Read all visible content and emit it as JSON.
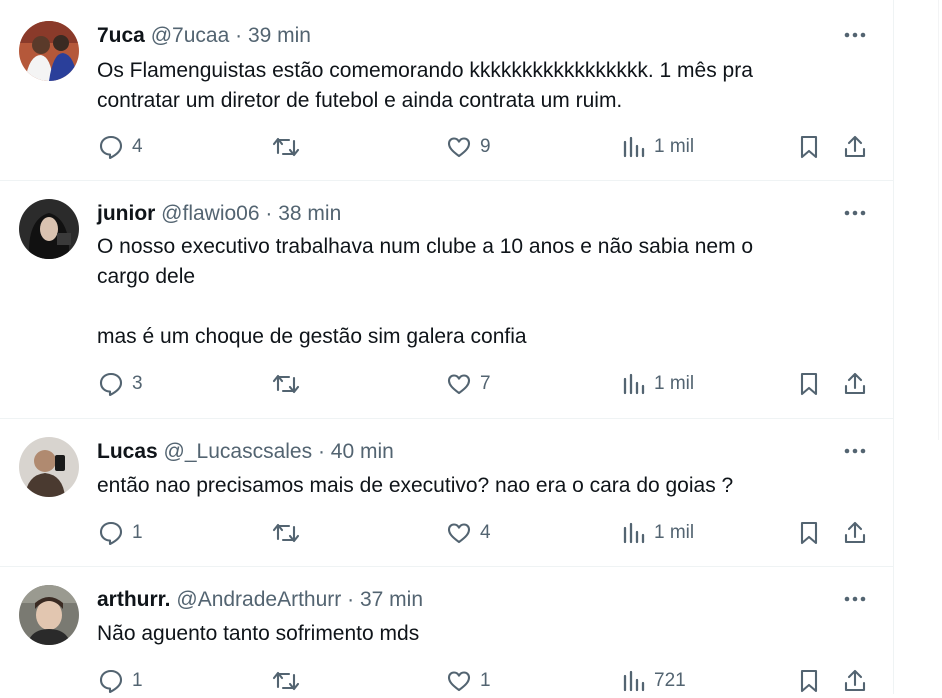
{
  "tweets": [
    {
      "name": "7uca",
      "handle": "@7ucaa",
      "dot": "·",
      "time": "39 min",
      "text": "Os Flamenguistas estão comemorando kkkkkkkkkkkkkkkkk. 1 mês pra\ncontratar um diretor de futebol e ainda contrata um ruim.",
      "replies": "4",
      "reposts": "",
      "likes": "9",
      "views": "1 mil"
    },
    {
      "name": "junior",
      "handle": "@flawio06",
      "dot": "·",
      "time": "38 min",
      "text": "O nosso executivo trabalhava num clube a 10 anos e não sabia nem o\ncargo dele\n\nmas é um choque de gestão sim galera confia",
      "replies": "3",
      "reposts": "",
      "likes": "7",
      "views": "1 mil"
    },
    {
      "name": "Lucas",
      "handle": "@_Lucascsales",
      "dot": "·",
      "time": "40 min",
      "text": "então nao precisamos mais de executivo? nao era o cara do goias ?",
      "replies": "1",
      "reposts": "",
      "likes": "4",
      "views": "1 mil"
    },
    {
      "name": "arthurr.",
      "handle": "@AndradeArthurr",
      "dot": "·",
      "time": "37 min",
      "text": "Não aguento tanto sofrimento mds",
      "replies": "1",
      "reposts": "",
      "likes": "1",
      "views": "721"
    }
  ],
  "icons": {
    "reply": "reply-icon",
    "repost": "repost-icon",
    "like": "heart-icon",
    "views": "views-icon",
    "bookmark": "bookmark-icon",
    "share": "share-icon",
    "more": "more-icon"
  },
  "colors": {
    "text": "#0f1419",
    "secondary": "#536471",
    "border": "#eff3f4"
  }
}
